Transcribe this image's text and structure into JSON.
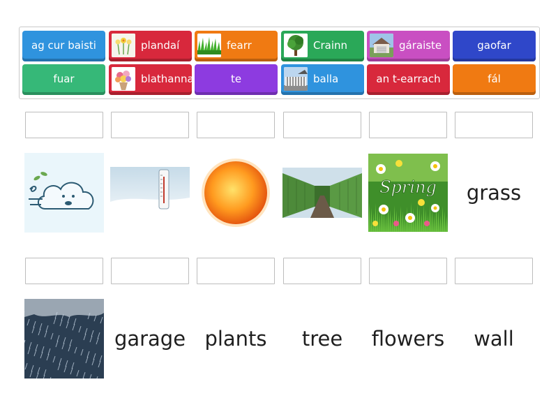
{
  "colors": {
    "blue": "#2f93de",
    "red": "#d8283c",
    "orange": "#f07a12",
    "green": "#2aa858",
    "pink": "#c94fc2",
    "navy": "#2f47c9",
    "teal": "#36b878",
    "purple": "#8d3be0"
  },
  "word_bank": [
    {
      "label": "ag cur baisti",
      "color": "blue",
      "icon": null
    },
    {
      "label": "plandaí",
      "color": "red",
      "icon": "plants-thumb-icon"
    },
    {
      "label": "fearr",
      "color": "orange",
      "icon": "grass-thumb-icon"
    },
    {
      "label": "Crainn",
      "color": "green",
      "icon": "tree-thumb-icon"
    },
    {
      "label": "gáraiste",
      "color": "pink",
      "icon": "garage-thumb-icon"
    },
    {
      "label": "gaofar",
      "color": "navy",
      "icon": null
    },
    {
      "label": "fuar",
      "color": "teal",
      "icon": null
    },
    {
      "label": "blathanna",
      "color": "red",
      "icon": "flowers-thumb-icon"
    },
    {
      "label": "te",
      "color": "purple",
      "icon": null
    },
    {
      "label": "balla",
      "color": "blue",
      "icon": "wall-thumb-icon"
    },
    {
      "label": "an t-earrach",
      "color": "red",
      "icon": null
    },
    {
      "label": "fál",
      "color": "orange",
      "icon": null
    }
  ],
  "targets": [
    {
      "type": "image",
      "icon": "windy-cloud-icon"
    },
    {
      "type": "image",
      "icon": "cold-thermometer-icon"
    },
    {
      "type": "image",
      "icon": "hot-sun-icon"
    },
    {
      "type": "image",
      "icon": "hedge-fence-icon"
    },
    {
      "type": "image",
      "icon": "spring-flowers-icon"
    },
    {
      "type": "text",
      "text": "grass"
    },
    {
      "type": "image",
      "icon": "rain-icon"
    },
    {
      "type": "text",
      "text": "garage"
    },
    {
      "type": "text",
      "text": "plants"
    },
    {
      "type": "text",
      "text": "tree"
    },
    {
      "type": "text",
      "text": "flowers"
    },
    {
      "type": "text",
      "text": "wall"
    }
  ],
  "spring_label": "Spring"
}
